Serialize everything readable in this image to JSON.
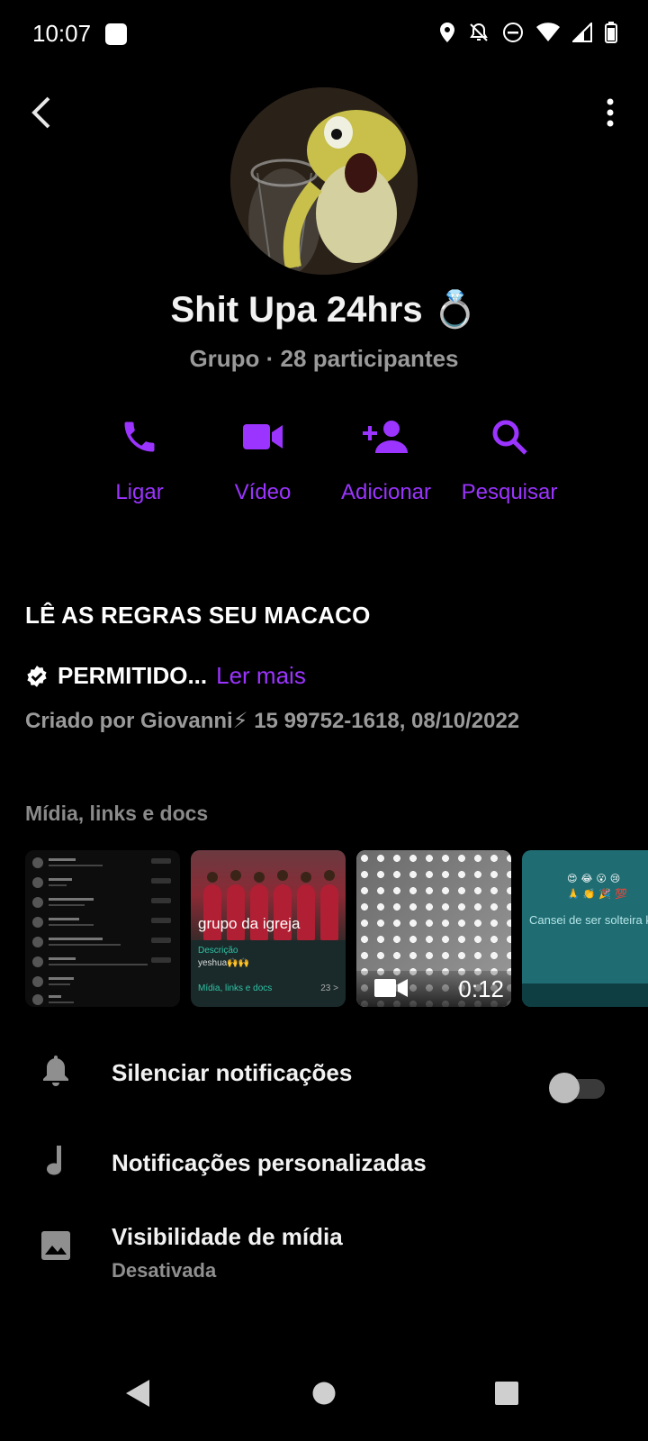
{
  "status_bar": {
    "time": "10:07"
  },
  "group": {
    "name": "Shit Upa 24hrs 💍",
    "subtitle": "Grupo · 28 participantes"
  },
  "actions": [
    {
      "label": "Ligar",
      "icon": "phone-icon"
    },
    {
      "label": "Vídeo",
      "icon": "video-camera-icon"
    },
    {
      "label": "Adicionar",
      "icon": "add-person-icon"
    },
    {
      "label": "Pesquisar",
      "icon": "search-icon"
    }
  ],
  "description": {
    "title": "LÊ AS REGRAS SEU MACACO",
    "allowed_text": "PERMITIDO...",
    "read_more": "Ler mais",
    "created_by": "Criado por Giovanni⚡ 15 99752-1618, 08/10/2022"
  },
  "media": {
    "title": "Mídia, links e docs",
    "thumb2": {
      "caption": "grupo da igreja",
      "desc_label": "Descrição",
      "desc_value": "yeshua🙌🙌",
      "media_label": "Mídia, links e docs",
      "media_count": "23 >"
    },
    "thumb3": {
      "duration": "0:12"
    },
    "thumb4": {
      "text": "Cansei de ser solteira k"
    }
  },
  "settings": {
    "mute": {
      "label": "Silenciar notificações",
      "icon": "bell-icon",
      "enabled": false
    },
    "custom": {
      "label": "Notificações personalizadas",
      "icon": "music-note-icon"
    },
    "visibility": {
      "label": "Visibilidade de mídia",
      "value": "Desativada",
      "icon": "image-icon"
    }
  },
  "colors": {
    "accent": "#9b34ff",
    "background": "#000000",
    "muted": "#9a9a9a"
  }
}
